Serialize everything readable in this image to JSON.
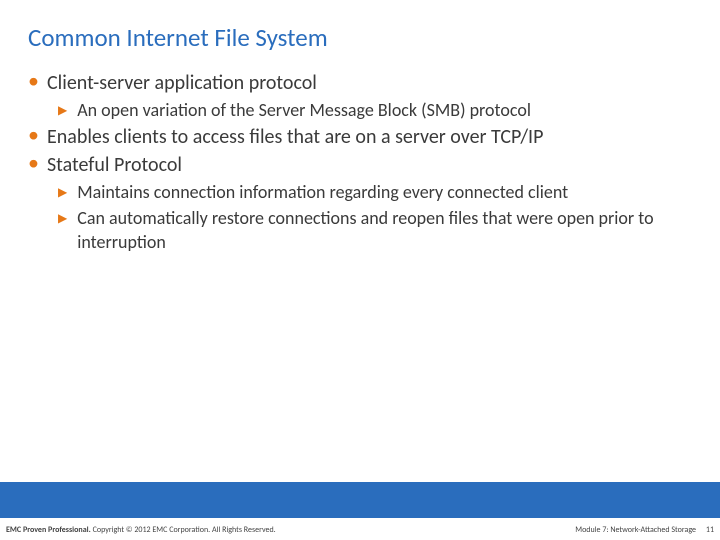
{
  "title": "Common Internet File System",
  "bullets": {
    "b1": "Client-server application protocol",
    "b1_1": "An open variation of the Server Message Block (SMB) protocol",
    "b2": "Enables clients to access files that are on a server over TCP/IP",
    "b3": "Stateful Protocol",
    "b3_1": "Maintains connection information regarding every connected client",
    "b3_2": "Can automatically restore connections and reopen files that were open prior to interruption"
  },
  "footer": {
    "left_strong": "EMC Proven Professional.",
    "left_rest": " Copyright © 2012 EMC Corporation. All Rights Reserved.",
    "right": "Module 7: Network-Attached Storage",
    "page": "11"
  }
}
